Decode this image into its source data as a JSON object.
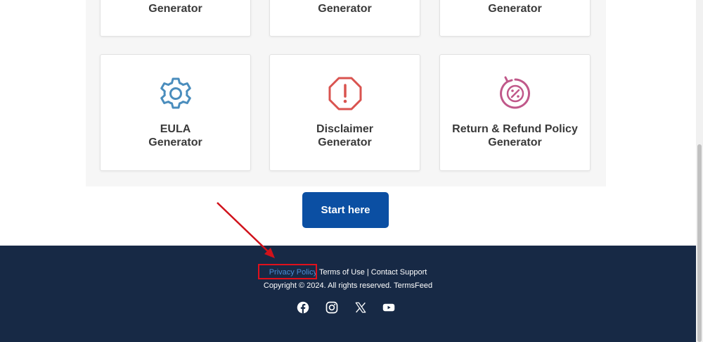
{
  "cards": {
    "top_row": [
      {
        "label": "Generator"
      },
      {
        "label": "Generator"
      },
      {
        "label": "Generator"
      }
    ],
    "eula": {
      "line1": "EULA",
      "line2": "Generator",
      "icon": "gear-icon"
    },
    "disclaimer": {
      "line1": "Disclaimer",
      "line2": "Generator",
      "icon": "warning-octagon-icon"
    },
    "refund": {
      "line1": "Return & Refund Policy",
      "line2": "Generator",
      "icon": "refund-percent-icon"
    }
  },
  "start_button": {
    "label": "Start here"
  },
  "footer": {
    "privacy_policy": "Privacy Policy",
    "terms_of_use": "Terms of Use",
    "separator": "|",
    "contact_support": "Contact Support",
    "copyright": "Copyright © 2024. All rights reserved. TermsFeed",
    "social_icons": [
      "facebook-icon",
      "instagram-icon",
      "x-icon",
      "youtube-icon"
    ]
  },
  "colors": {
    "footer_bg": "#172945",
    "button_bg": "#0b4fa3",
    "link_blue": "#4a8ed8",
    "highlight_red": "#e0101b",
    "gear_blue": "#4a8dbd",
    "warning_red": "#d9534f",
    "refund_pink": "#c0588a"
  }
}
